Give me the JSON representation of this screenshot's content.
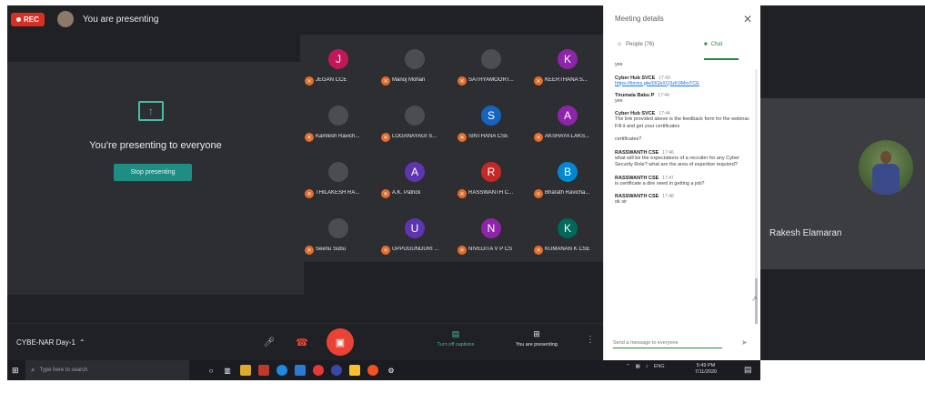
{
  "meet": {
    "rec_label": "REC",
    "presenting_title": "You are presenting",
    "present_message": "You're presenting to everyone",
    "stop_button": "Stop presenting",
    "meeting_name": "CYBE-NAR Day-1",
    "captions_label": "Turn off captions",
    "presenting_label": "You are presenting"
  },
  "participants": [
    {
      "initial": "J",
      "name": "JEGAN CCE",
      "color": "#c2185b",
      "photo": false
    },
    {
      "initial": "",
      "name": "Manoj Mohan",
      "color": "#4a4d52",
      "photo": true
    },
    {
      "initial": "",
      "name": "SATHYAMOORT...",
      "color": "#4a4d52",
      "photo": true
    },
    {
      "initial": "K",
      "name": "KEERTHANA S...",
      "color": "#8e24aa",
      "photo": false
    },
    {
      "initial": "",
      "name": "Kamlesh Ravich...",
      "color": "#4a4d52",
      "photo": true
    },
    {
      "initial": "",
      "name": "LOGANAYAGI S...",
      "color": "#4a4d52",
      "photo": true
    },
    {
      "initial": "S",
      "name": "SINTHANA CSE",
      "color": "#1565c0",
      "photo": false
    },
    {
      "initial": "A",
      "name": "AKSHAYA LAKS...",
      "color": "#8e24aa",
      "photo": false
    },
    {
      "initial": "",
      "name": "THILAKESH RA...",
      "color": "#4a4d52",
      "photo": true
    },
    {
      "initial": "A",
      "name": "A.K. Patrick",
      "color": "#5e35b1",
      "photo": false
    },
    {
      "initial": "R",
      "name": "RASSWANTH C...",
      "color": "#c62828",
      "photo": false
    },
    {
      "initial": "B",
      "name": "Bharath Ravicha...",
      "color": "#0288d1",
      "photo": false
    },
    {
      "initial": "",
      "name": "Seenu Subu",
      "color": "#4a4d52",
      "photo": true
    },
    {
      "initial": "U",
      "name": "UPPUGUNDURI ...",
      "color": "#5e35b1",
      "photo": false
    },
    {
      "initial": "N",
      "name": "NIVEDITA V P CS",
      "color": "#8e24aa",
      "photo": false
    },
    {
      "initial": "K",
      "name": "KUMANAN K CSE",
      "color": "#00695c",
      "photo": false
    }
  ],
  "details": {
    "title": "Meeting details",
    "tab_people": "People (76)",
    "tab_chat": "Chat",
    "messages": [
      {
        "sender": "",
        "time": "",
        "text": "yes",
        "link": ""
      },
      {
        "sender": "Cyber Hub SVCE",
        "time": "17:43",
        "text": "",
        "link": "https://forms.gle/t3GkXQ3zK9MmTCE"
      },
      {
        "sender": "Tirumala Babu P",
        "time": "17:44",
        "text": "yes",
        "link": ""
      },
      {
        "sender": "Cyber Hub SVCE",
        "time": "17:44",
        "text": "The link provided above is the feedback form for the webinar. Fill it and get your certificates",
        "link": ""
      },
      {
        "sender": "",
        "time": "",
        "text": "certificates?",
        "link": ""
      },
      {
        "sender": "RASSWANTH CSE",
        "time": "17:46",
        "text": "what will be the expectations of a recruiter for any Cyber Security Role? what are the area of expertise required?",
        "link": ""
      },
      {
        "sender": "RASSWANTH CSE",
        "time": "17:47",
        "text": "is certificate a dire need in getting a job?",
        "link": ""
      },
      {
        "sender": "RASSWANTH CSE",
        "time": "17:48",
        "text": "ok sir",
        "link": ""
      }
    ],
    "input_placeholder": "Send a message to everyone"
  },
  "taskbar": {
    "search_placeholder": "Type here to search",
    "tray_text": "ENG",
    "time": "5:49 PM",
    "date": "7/11/2020"
  },
  "right": {
    "name": "Rakesh Elamaran"
  }
}
